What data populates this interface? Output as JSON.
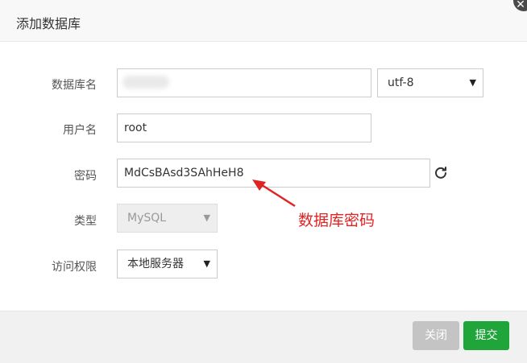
{
  "dialog": {
    "title": "添加数据库",
    "close_glyph": "✕"
  },
  "form": {
    "db_name": {
      "label": "数据库名",
      "value": ""
    },
    "charset": {
      "value": "utf-8"
    },
    "username": {
      "label": "用户名",
      "value": "root"
    },
    "password": {
      "label": "密码",
      "value": "MdCsBAsd3SAhHeH8"
    },
    "type": {
      "label": "类型",
      "value": "MySQL"
    },
    "access": {
      "label": "访问权限",
      "value": "本地服务器"
    }
  },
  "annotation": {
    "text": "数据库密码",
    "color": "#e02424"
  },
  "footer": {
    "close_label": "关闭",
    "submit_label": "提交"
  },
  "colors": {
    "submit": "#20a53a",
    "close": "#c4c4c4"
  }
}
